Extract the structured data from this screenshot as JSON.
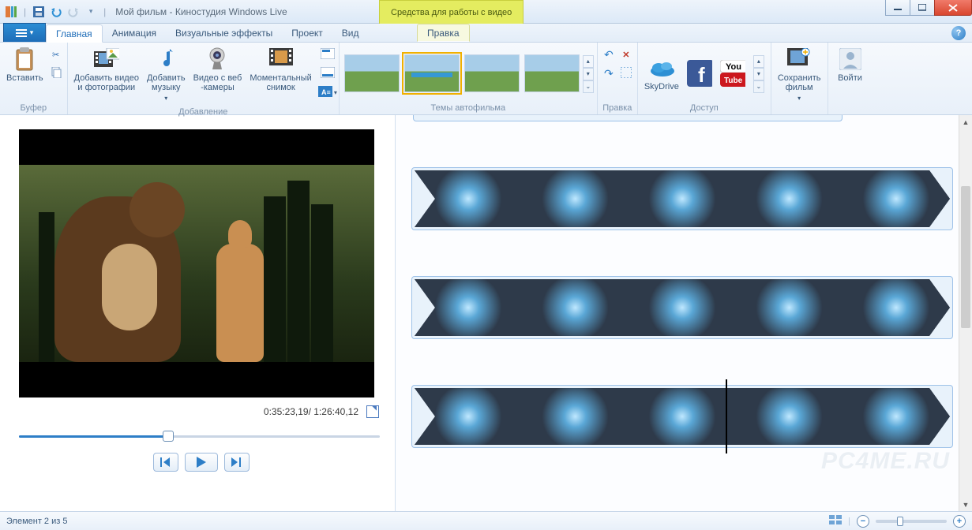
{
  "titlebar": {
    "title": "Мой фильм - Киностудия Windows Live",
    "contextual_tab_header": "Средства для работы с видео"
  },
  "tabs": {
    "home": "Главная",
    "animation": "Анимация",
    "visual_effects": "Визуальные эффекты",
    "project": "Проект",
    "view": "Вид",
    "edit_context": "Правка"
  },
  "ribbon": {
    "buffer": {
      "paste": "Вставить",
      "group": "Буфер"
    },
    "add": {
      "add_video_photo": "Добавить видео\nи фотографии",
      "add_music": "Добавить\nмузыку",
      "webcam": "Видео с веб\n-камеры",
      "snapshot": "Моментальный\nснимок",
      "group": "Добавление"
    },
    "themes": {
      "group": "Темы автофильма"
    },
    "edit": {
      "group": "Правка"
    },
    "share": {
      "skydrive": "SkyDrive",
      "youtube_text": "You",
      "group": "Доступ"
    },
    "save": {
      "save_movie": "Сохранить\nфильм",
      "group": ""
    },
    "signin": {
      "signin": "Войти",
      "group": ""
    }
  },
  "preview": {
    "timecode": "0:35:23,19/ 1:26:40,12",
    "seek_percent": 41
  },
  "statusbar": {
    "item_of": "Элемент 2 из 5"
  },
  "watermark": "PC4ME.RU"
}
